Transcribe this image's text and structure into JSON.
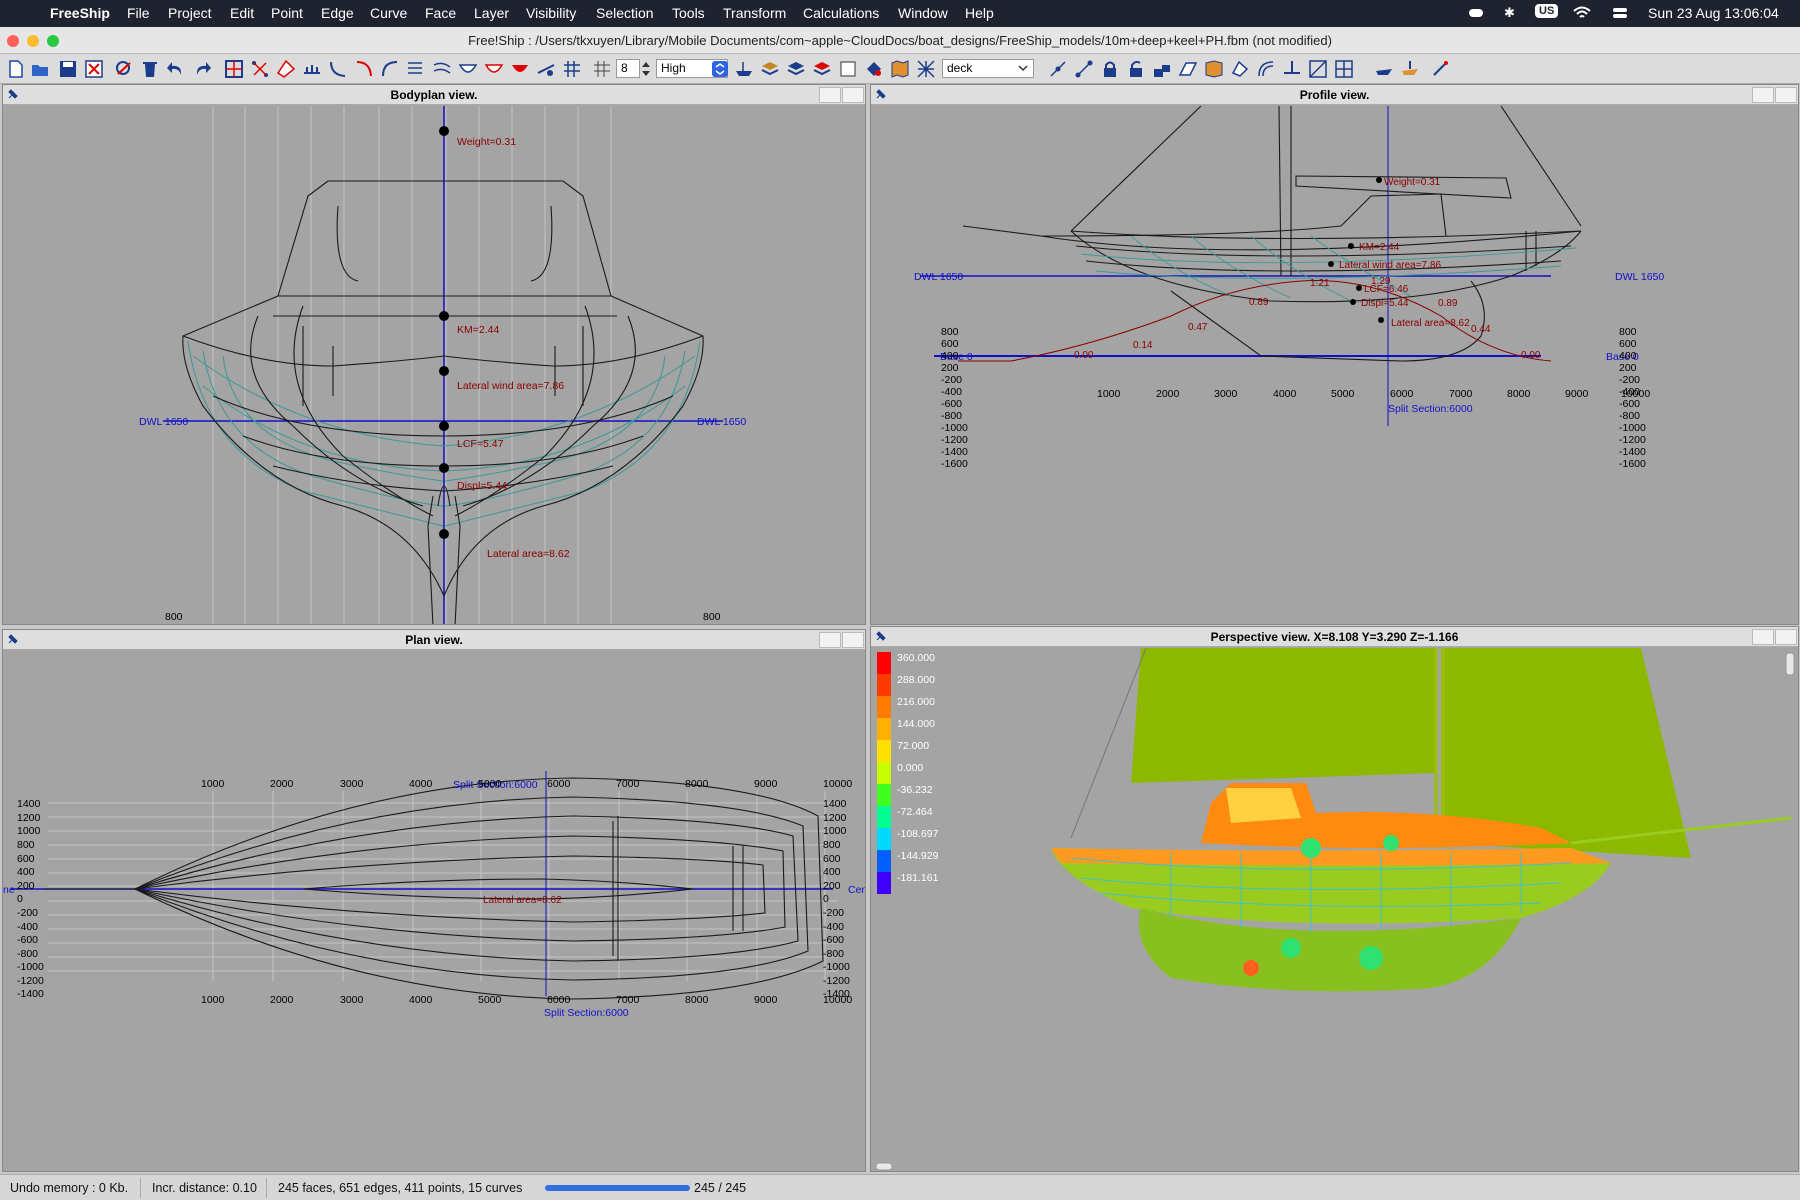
{
  "menubar": {
    "app": "FreeShip",
    "items": [
      "File",
      "Project",
      "Edit",
      "Point",
      "Edge",
      "Curve",
      "Face",
      "Layer",
      "Visibility",
      "Selection",
      "Tools",
      "Transform",
      "Calculations",
      "Window",
      "Help"
    ],
    "input_source": "US",
    "datetime": "Sun 23 Aug  13:06:04"
  },
  "window": {
    "title": "Free!Ship  : /Users/tkxuyen/Library/Mobile Documents/com~apple~CloudDocs/boat_designs/FreeShip_models/10m+deep+keel+PH.fbm (not modified)"
  },
  "toolbar": {
    "precision_value": "8",
    "quality": "High",
    "layer": "deck"
  },
  "bodyplan": {
    "title": "Bodyplan view.",
    "labels": {
      "weight": "Weight=0.31",
      "km": "KM=2.44",
      "lwa": "Lateral wind area=7.86",
      "lcf": "LCF=5.47",
      "displ": "Displ=5.44",
      "lat": "Lateral area=8.62",
      "dwl_l": "DWL 1650",
      "dwl_r": "DWL 1650",
      "b_l": "800",
      "b_r": "800"
    }
  },
  "profile": {
    "title": "Profile view.",
    "labels": {
      "weight": "Weight=0.31",
      "km": "KM=2.44",
      "lwa": "Lateral wind area=7.86",
      "lcf": "LCF=6.46",
      "displ": "Displ=5.44",
      "lat": "Lateral area=8.62",
      "dwl_l": "DWL 1650",
      "dwl_r": "DWL 1650",
      "base_l": "Base 0",
      "base_r": "Base 0",
      "split": "Split Section:6000"
    },
    "x_ticks": [
      "1000",
      "2000",
      "3000",
      "4000",
      "5000",
      "6000",
      "7000",
      "8000",
      "9000",
      "10000"
    ],
    "y_ticks": [
      "800",
      "600",
      "400",
      "200",
      "-200",
      "-400",
      "-600",
      "-800",
      "-1000",
      "-1200",
      "-1400",
      "-1600"
    ],
    "curve_values": [
      "0.00",
      "0.14",
      "0.47",
      "0.89",
      "1.21",
      "1.29",
      "0.89",
      "0.44",
      "0.00"
    ]
  },
  "plan": {
    "title": "Plan view.",
    "split_top": "Split Section:6000",
    "split_bottom": "Split Section:6000",
    "centre_l": "ne",
    "centre_r": "Cen",
    "lat": "Lateral area=8.62",
    "x_ticks": [
      "1000",
      "2000",
      "3000",
      "4000",
      "5000",
      "6000",
      "7000",
      "8000",
      "9000",
      "10000"
    ],
    "y_ticks": [
      "1400",
      "1200",
      "1000",
      "800",
      "600",
      "400",
      "200",
      "0",
      "0",
      "-200",
      "-400",
      "-600",
      "-800",
      "-1000",
      "-1200",
      "-1400"
    ]
  },
  "perspective": {
    "title": "Perspective view.   X=8.108   Y=3.290   Z=-1.166",
    "legend": [
      {
        "v": "360.000",
        "c": "#ff0000"
      },
      {
        "v": "288.000",
        "c": "#ff3a00"
      },
      {
        "v": "216.000",
        "c": "#ff7a00"
      },
      {
        "v": "144.000",
        "c": "#ffb000"
      },
      {
        "v": "72.000",
        "c": "#ffe000"
      },
      {
        "v": "0.000",
        "c": "#c8ff00"
      },
      {
        "v": "-36.232",
        "c": "#40ff20"
      },
      {
        "v": "-72.464",
        "c": "#00ff90"
      },
      {
        "v": "-108.697",
        "c": "#00d8ff"
      },
      {
        "v": "-144.929",
        "c": "#0060ff"
      },
      {
        "v": "-181.161",
        "c": "#4000ff"
      }
    ]
  },
  "status": {
    "undo": "Undo memory : 0 Kb.",
    "incr": "Incr. distance: 0.10",
    "counts": "245 faces, 651 edges, 411 points, 15 curves",
    "progress": "245 / 245",
    "progress_fraction": 1.0
  }
}
